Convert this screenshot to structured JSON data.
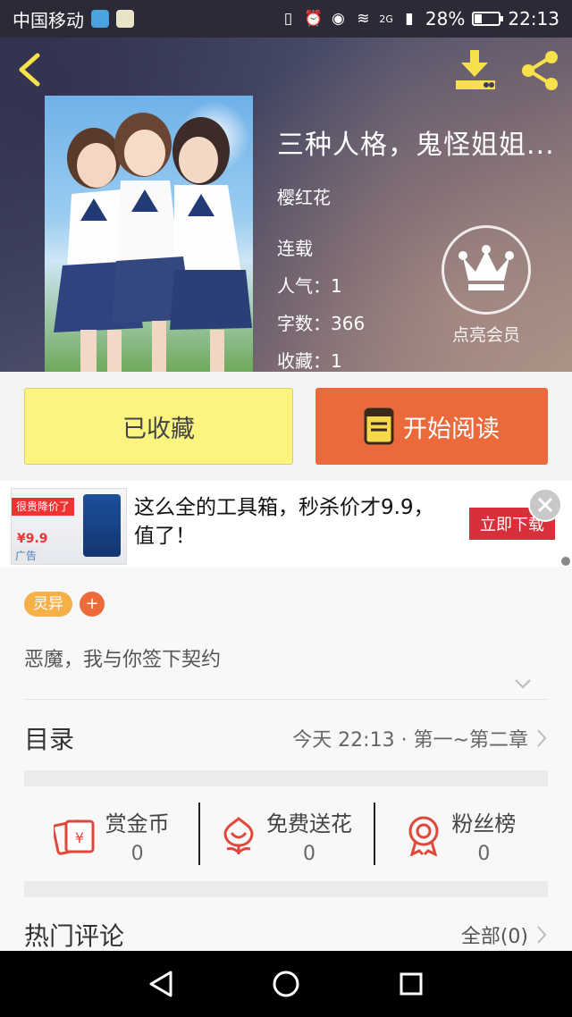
{
  "status_bar": {
    "carrier": "中国移动",
    "network": "2G",
    "battery": "28%",
    "battery_level": 0.28,
    "time": "22:13"
  },
  "header": {
    "back_icon": "back-arrow-icon",
    "download_icon": "download-icon",
    "share_icon": "share-icon"
  },
  "book": {
    "title": "三种人格，鬼怪姐姐...",
    "author": "樱红花",
    "status": "连载",
    "popularity": "人气：1",
    "word_count": "字数：366",
    "favorites": "收藏：1",
    "vip_label": "点亮会员"
  },
  "actions": {
    "favorite_label": "已收藏",
    "read_label": "开始阅读"
  },
  "ad": {
    "image_tag": "很贵降价了",
    "image_price": "¥9.9",
    "image_badge": "广告",
    "text": "这么全的工具箱，秒杀价才9.9，值了！",
    "cta": "立即下载"
  },
  "detail": {
    "genre_tag": "灵异",
    "add_tag": "+",
    "description": "恶魔，我与你签下契约",
    "toc_label": "目录",
    "toc_latest": "今天 22:13 · 第一~第二章",
    "stats": [
      {
        "name": "赏金币",
        "value": "0",
        "icon": "red-envelope-icon"
      },
      {
        "name": "免费送花",
        "value": "0",
        "icon": "flower-icon"
      },
      {
        "name": "粉丝榜",
        "value": "0",
        "icon": "medal-icon"
      }
    ],
    "comments_label": "热门评论",
    "comments_all": "全部(0)"
  },
  "colors": {
    "favorite_bg": "#fbf47e",
    "read_bg": "#ea6a3c",
    "accent_icons": "#f7e14a",
    "stat_icon": "#e0463a"
  }
}
